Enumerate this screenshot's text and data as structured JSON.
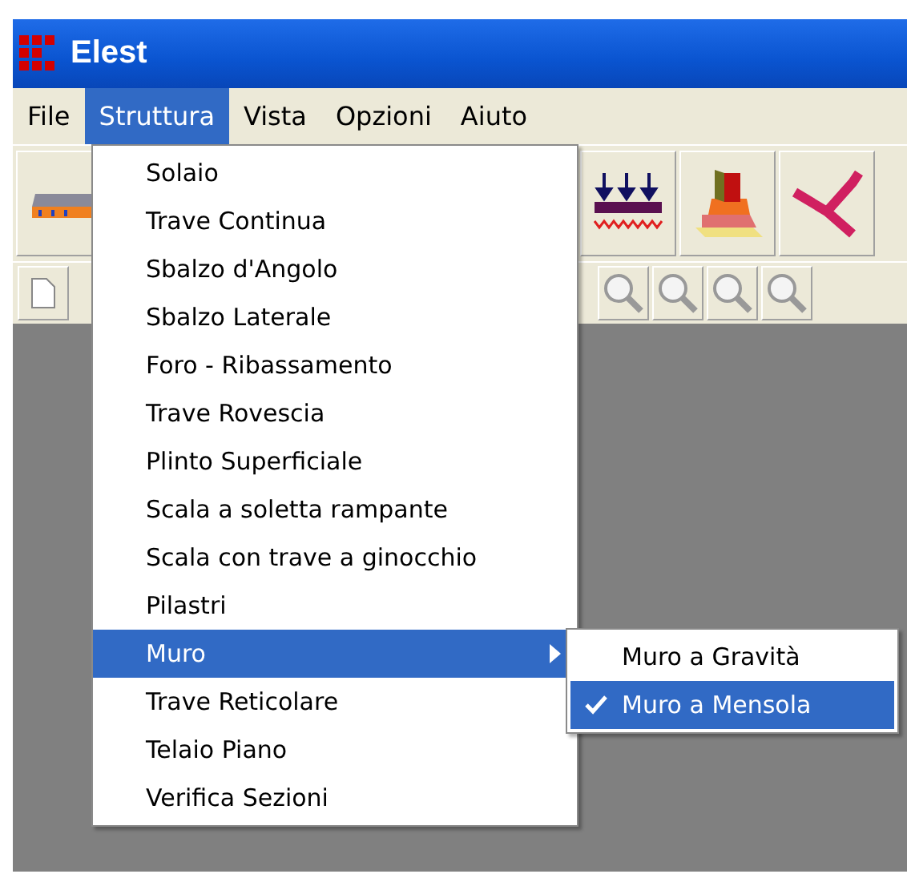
{
  "window": {
    "title": "Elest"
  },
  "menu_bar": [
    {
      "label": "File",
      "selected": false
    },
    {
      "label": "Struttura",
      "selected": true
    },
    {
      "label": "Vista",
      "selected": false
    },
    {
      "label": "Opzioni",
      "selected": false
    },
    {
      "label": "Aiuto",
      "selected": false
    }
  ],
  "dropdown": [
    {
      "label": "Solaio",
      "selected": false,
      "has_submenu": false
    },
    {
      "label": "Trave Continua",
      "selected": false,
      "has_submenu": false
    },
    {
      "label": "Sbalzo d'Angolo",
      "selected": false,
      "has_submenu": false
    },
    {
      "label": "Sbalzo Laterale",
      "selected": false,
      "has_submenu": false
    },
    {
      "label": "Foro - Ribassamento",
      "selected": false,
      "has_submenu": false
    },
    {
      "label": "Trave Rovescia",
      "selected": false,
      "has_submenu": false
    },
    {
      "label": "Plinto Superficiale",
      "selected": false,
      "has_submenu": false
    },
    {
      "label": "Scala a soletta rampante",
      "selected": false,
      "has_submenu": false
    },
    {
      "label": "Scala con trave a ginocchio",
      "selected": false,
      "has_submenu": false
    },
    {
      "label": "Pilastri",
      "selected": false,
      "has_submenu": false
    },
    {
      "label": "Muro",
      "selected": true,
      "has_submenu": true
    },
    {
      "label": "Trave Reticolare",
      "selected": false,
      "has_submenu": false
    },
    {
      "label": "Telaio Piano",
      "selected": false,
      "has_submenu": false
    },
    {
      "label": "Verifica Sezioni",
      "selected": false,
      "has_submenu": false
    }
  ],
  "submenu": [
    {
      "label": "Muro a Gravità",
      "selected": false,
      "checked": false
    },
    {
      "label": "Muro a Mensola",
      "selected": true,
      "checked": true
    }
  ]
}
